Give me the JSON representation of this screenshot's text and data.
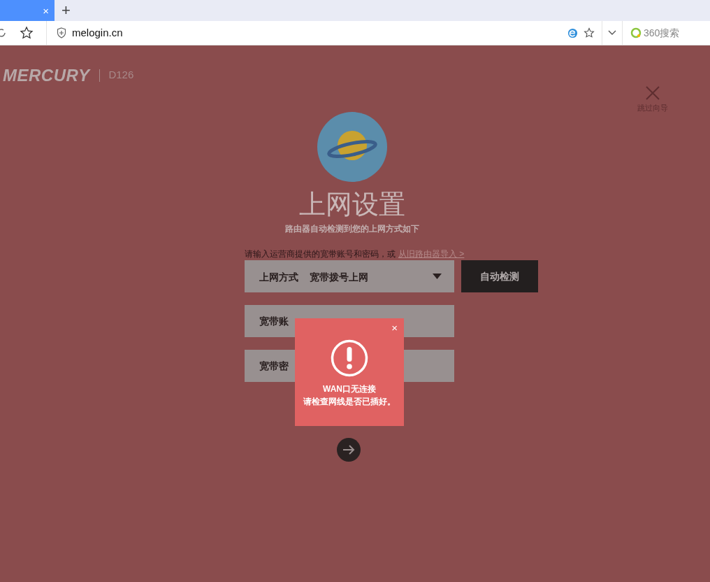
{
  "browser": {
    "tab_close": "×",
    "new_tab": "+",
    "url": "melogin.cn",
    "search_placeholder": "360搜索"
  },
  "header": {
    "brand": "MERCURY",
    "model": "D126",
    "skip_label": "跳过向导"
  },
  "setup": {
    "title": "上网设置",
    "subtitle": "路由器自动检测到您的上网方式如下",
    "instruction": "请输入运营商提供的宽带账号和密码，或",
    "import_link": "从旧路由器导入 >",
    "fields": [
      {
        "kind": "select",
        "label": "上网方式",
        "value": "宽带拨号上网"
      },
      {
        "kind": "text",
        "label": "宽带账"
      },
      {
        "kind": "text",
        "label": "宽带密"
      }
    ],
    "detect_button": "自动检测"
  },
  "dialog": {
    "close": "×",
    "lines": [
      "WAN口无连接",
      "请检查网线是否已插好。"
    ]
  }
}
